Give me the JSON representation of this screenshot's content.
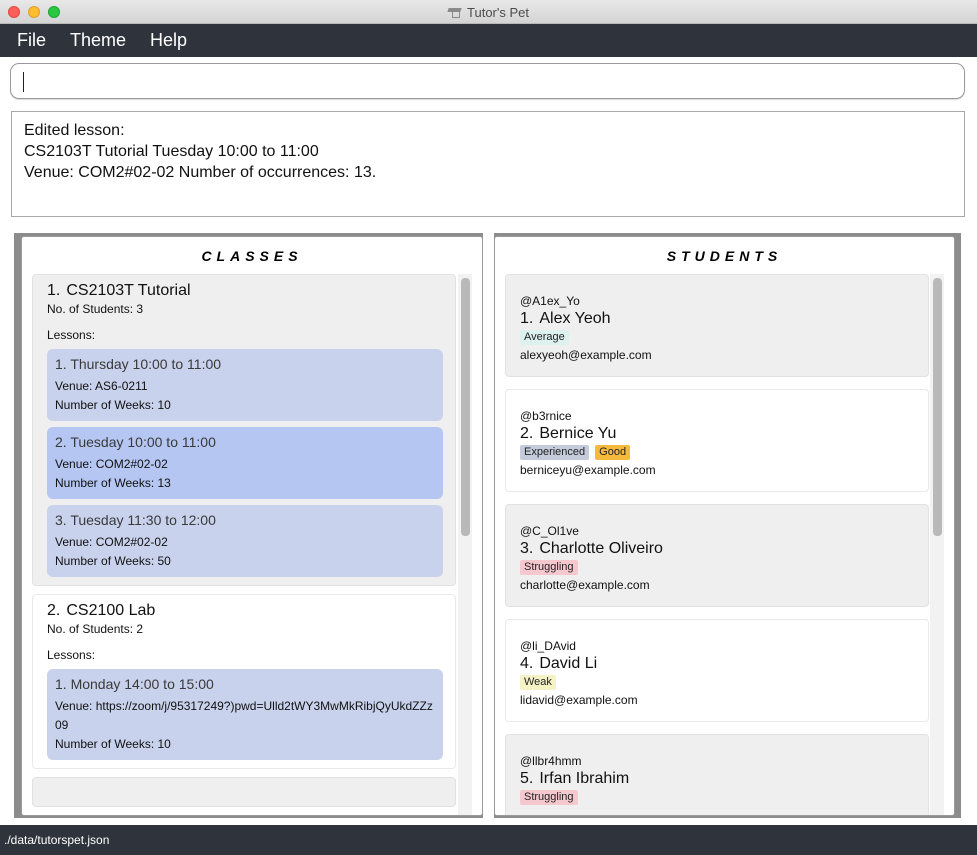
{
  "window": {
    "title": "Tutor's Pet"
  },
  "menu": {
    "file": "File",
    "theme": "Theme",
    "help": "Help"
  },
  "command": {
    "value": ""
  },
  "result": {
    "line1": "Edited lesson:",
    "line2": "CS2103T Tutorial Tuesday 10:00 to 11:00",
    "line3": "Venue: COM2#02-02 Number of occurrences: 13."
  },
  "classes_panel": {
    "title": "CLASSES",
    "classes": [
      {
        "index": "1.",
        "name": "CS2103T Tutorial",
        "students": "No. of Students:  3",
        "lessons_label": "Lessons:",
        "lessons": [
          {
            "time": "1. Thursday 10:00 to 11:00",
            "venue": "Venue: AS6-0211",
            "weeks": "Number of Weeks: 10"
          },
          {
            "time": "2. Tuesday 10:00 to 11:00",
            "venue": "Venue: COM2#02-02",
            "weeks": "Number of Weeks: 13"
          },
          {
            "time": "3. Tuesday 11:30 to 12:00",
            "venue": "Venue: COM2#02-02",
            "weeks": "Number of Weeks: 50"
          }
        ]
      },
      {
        "index": "2.",
        "name": "CS2100 Lab",
        "students": "No. of Students:  2",
        "lessons_label": "Lessons:",
        "lessons": [
          {
            "time": "1. Monday 14:00 to 15:00",
            "venue": "Venue: https://zoom/j/95317249?)pwd=Ulld2tWY3MwMkRibjQyUkdZZz09",
            "weeks": "Number of Weeks: 10"
          }
        ]
      }
    ]
  },
  "students_panel": {
    "title": "STUDENTS",
    "students": [
      {
        "handle": "@A1ex_Yo",
        "index": "1.",
        "name": "Alex Yeoh",
        "tags": [
          {
            "label": "Average",
            "color": "#ddf1ef"
          }
        ],
        "email": "alexyeoh@example.com"
      },
      {
        "handle": "@b3rnice",
        "index": "2.",
        "name": "Bernice Yu",
        "tags": [
          {
            "label": "Experienced",
            "color": "#c4ccdc"
          },
          {
            "label": "Good",
            "color": "#f5b93e"
          }
        ],
        "email": "berniceyu@example.com"
      },
      {
        "handle": "@C_Ol1ve",
        "index": "3.",
        "name": "Charlotte Oliveiro",
        "tags": [
          {
            "label": "Struggling",
            "color": "#f5c8cf"
          }
        ],
        "email": "charlotte@example.com"
      },
      {
        "handle": "@li_DAvid",
        "index": "4.",
        "name": "David Li",
        "tags": [
          {
            "label": "Weak",
            "color": "#f5f3c6"
          }
        ],
        "email": "lidavid@example.com"
      },
      {
        "handle": "@llbr4hmm",
        "index": "5.",
        "name": "Irfan Ibrahim",
        "tags": [
          {
            "label": "Struggling",
            "color": "#f5c8cf"
          }
        ],
        "email": ""
      }
    ]
  },
  "status": {
    "path": "./data/tutorspet.json"
  }
}
